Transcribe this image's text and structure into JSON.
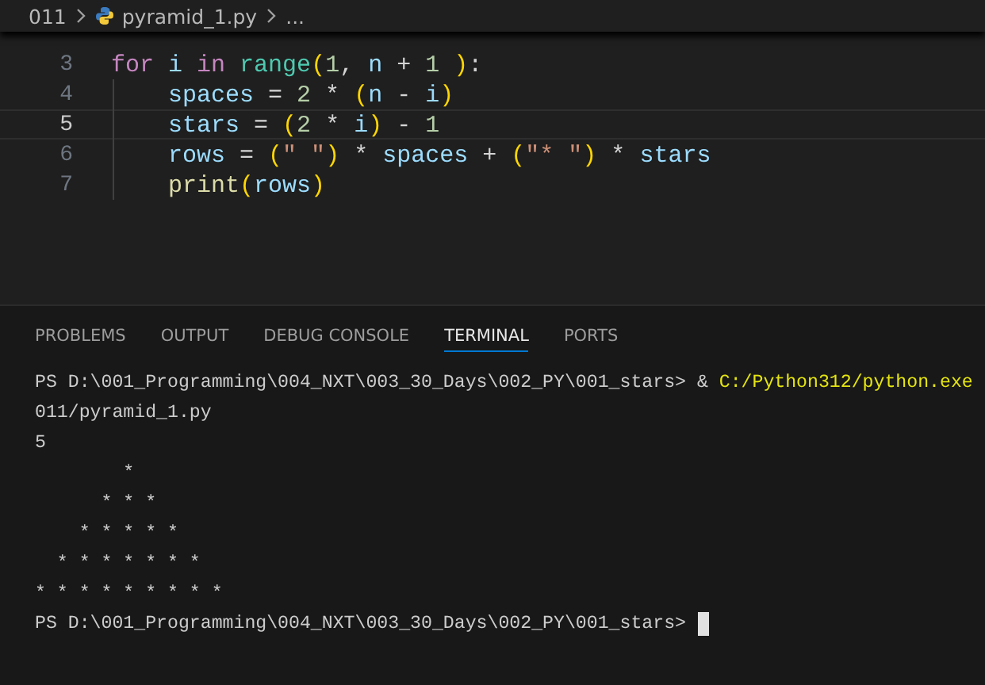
{
  "breadcrumb": [
    {
      "kind": "folder",
      "text": "011"
    },
    {
      "kind": "file",
      "text": "pyramid_1.py"
    },
    {
      "kind": "more",
      "text": "..."
    }
  ],
  "editor": {
    "lines": [
      {
        "number": "3",
        "current": false,
        "indent": false,
        "tokens": [
          {
            "kind": "keyword",
            "text": "for"
          },
          {
            "kind": "var",
            "text": " i"
          },
          {
            "kind": "keyword",
            "text": " in"
          },
          {
            "kind": "builtin",
            "text": " range"
          },
          {
            "kind": "bracket",
            "text": "("
          },
          {
            "kind": "number",
            "text": "1"
          },
          {
            "kind": "plain",
            "text": ", "
          },
          {
            "kind": "var",
            "text": "n"
          },
          {
            "kind": "plain",
            "text": " + "
          },
          {
            "kind": "number",
            "text": "1"
          },
          {
            "kind": "bracket",
            "text": " )"
          },
          {
            "kind": "plain",
            "text": ":"
          }
        ]
      },
      {
        "number": "4",
        "current": false,
        "indent": true,
        "tokens": [
          {
            "kind": "var",
            "text": "spaces"
          },
          {
            "kind": "plain",
            "text": " = "
          },
          {
            "kind": "number",
            "text": "2"
          },
          {
            "kind": "plain",
            "text": " * "
          },
          {
            "kind": "bracket",
            "text": "("
          },
          {
            "kind": "var",
            "text": "n"
          },
          {
            "kind": "plain",
            "text": " - "
          },
          {
            "kind": "var",
            "text": "i"
          },
          {
            "kind": "bracket",
            "text": ")"
          }
        ]
      },
      {
        "number": "5",
        "current": true,
        "indent": true,
        "tokens": [
          {
            "kind": "var",
            "text": "stars"
          },
          {
            "kind": "plain",
            "text": " = "
          },
          {
            "kind": "bracket",
            "text": "("
          },
          {
            "kind": "number",
            "text": "2"
          },
          {
            "kind": "plain",
            "text": " * "
          },
          {
            "kind": "var",
            "text": "i"
          },
          {
            "kind": "bracket",
            "text": ")"
          },
          {
            "kind": "plain",
            "text": " - "
          },
          {
            "kind": "number",
            "text": "1"
          }
        ]
      },
      {
        "number": "6",
        "current": false,
        "indent": true,
        "tokens": [
          {
            "kind": "var",
            "text": "rows"
          },
          {
            "kind": "plain",
            "text": " = "
          },
          {
            "kind": "bracket",
            "text": "("
          },
          {
            "kind": "string",
            "text": "\" \""
          },
          {
            "kind": "bracket",
            "text": ")"
          },
          {
            "kind": "plain",
            "text": " * "
          },
          {
            "kind": "var",
            "text": "spaces"
          },
          {
            "kind": "plain",
            "text": " + "
          },
          {
            "kind": "bracket",
            "text": "("
          },
          {
            "kind": "string",
            "text": "\"* \""
          },
          {
            "kind": "bracket",
            "text": ")"
          },
          {
            "kind": "plain",
            "text": " * "
          },
          {
            "kind": "var",
            "text": "stars"
          }
        ]
      },
      {
        "number": "7",
        "current": false,
        "indent": true,
        "tokens": [
          {
            "kind": "func",
            "text": "print"
          },
          {
            "kind": "bracket",
            "text": "("
          },
          {
            "kind": "var",
            "text": "rows"
          },
          {
            "kind": "bracket",
            "text": ")"
          }
        ]
      }
    ]
  },
  "panel": {
    "tabs": [
      {
        "label": "PROBLEMS",
        "selected": false
      },
      {
        "label": "OUTPUT",
        "selected": false
      },
      {
        "label": "DEBUG CONSOLE",
        "selected": false
      },
      {
        "label": "TERMINAL",
        "selected": true
      },
      {
        "label": "PORTS",
        "selected": false
      }
    ]
  },
  "terminal": {
    "lines": [
      {
        "cursor": false,
        "segments": [
          {
            "kind": "plain",
            "text": "PS D:\\001_Programming\\004_NXT\\003_30_Days\\002_PY\\001_stars> & "
          },
          {
            "kind": "path",
            "text": "C:/Python312/python.exe"
          }
        ]
      },
      {
        "cursor": false,
        "segments": [
          {
            "kind": "plain",
            "text": "011/pyramid_1.py"
          }
        ]
      },
      {
        "cursor": false,
        "segments": [
          {
            "kind": "plain",
            "text": "5"
          }
        ]
      },
      {
        "cursor": false,
        "segments": [
          {
            "kind": "plain",
            "text": "        *\n      * * *\n    * * * * *\n  * * * * * * *\n* * * * * * * * *"
          }
        ]
      },
      {
        "cursor": true,
        "segments": [
          {
            "kind": "plain",
            "text": "PS D:\\001_Programming\\004_NXT\\003_30_Days\\002_PY\\001_stars> "
          }
        ]
      }
    ]
  }
}
